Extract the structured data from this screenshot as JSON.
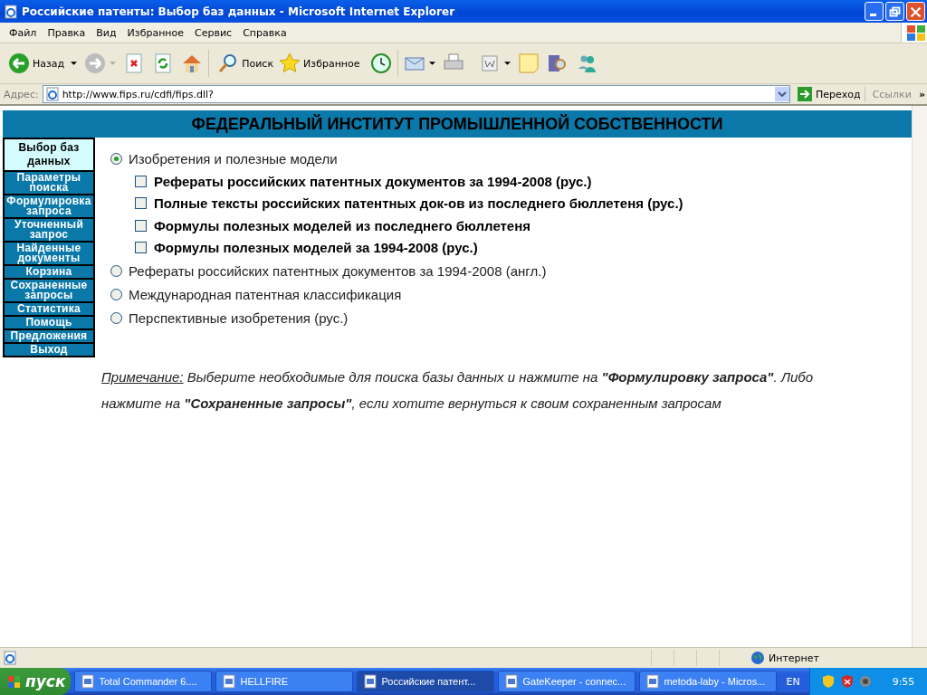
{
  "window": {
    "title": "Российские патенты: Выбор баз данных - Microsoft Internet Explorer"
  },
  "menu": [
    "Файл",
    "Правка",
    "Вид",
    "Избранное",
    "Сервис",
    "Справка"
  ],
  "toolbar": {
    "back": "Назад",
    "search": "Поиск",
    "favorites": "Избранное"
  },
  "address": {
    "label": "Адрес:",
    "value": "http://www.fips.ru/cdfi/fips.dll?",
    "go": "Переход",
    "links": "Ссылки",
    "more": "»"
  },
  "page": {
    "header": "ФЕДЕРАЛЬНЫЙ ИНСТИТУТ ПРОМЫШЛЕННОЙ СОБСТВЕННОСТИ",
    "sidebar": [
      {
        "label": "Выбор баз данных",
        "selected": true
      },
      {
        "label": "Параметры поиска",
        "selected": false
      },
      {
        "label": "Формулировка запроса",
        "selected": false
      },
      {
        "label": "Уточненный запрос",
        "selected": false
      },
      {
        "label": "Найденные документы",
        "selected": false
      },
      {
        "label": "Корзина",
        "selected": false
      },
      {
        "label": "Сохраненные запросы",
        "selected": false
      },
      {
        "label": "Статистика",
        "selected": false
      },
      {
        "label": "Помощь",
        "selected": false
      },
      {
        "label": "Предложения",
        "selected": false
      },
      {
        "label": "Выход",
        "selected": false
      }
    ],
    "databases": [
      {
        "label": "Изобретения и полезные модели",
        "selected": true,
        "children": [
          {
            "label": "Рефераты российских патентных документов за 1994-2008 (рус.)",
            "checked": false
          },
          {
            "label": "Полные тексты российских патентных док-ов из последнего бюллетеня (рус.)",
            "checked": false
          },
          {
            "label": "Формулы полезных моделей из последнего бюллетеня",
            "checked": false
          },
          {
            "label": "Формулы полезных моделей за 1994-2008 (рус.)",
            "checked": false
          }
        ]
      },
      {
        "label": "Рефераты российских патентных документов за 1994-2008 (англ.)",
        "selected": false
      },
      {
        "label": "Международная патентная классификация",
        "selected": false
      },
      {
        "label": "Перспективные изобретения (рус.)",
        "selected": false
      }
    ],
    "note": {
      "label": "Примечание:",
      "text": "Выберите необходимые для поиска базы данных и нажмите на **\"Формулировку запроса\"**. Либо нажмите на **\"Сохраненные запросы\"**, если хотите вернуться к своим сохраненным запросам"
    }
  },
  "status_bar": {
    "zone": "Интернет"
  },
  "taskbar": {
    "start": "пуск",
    "tasks": [
      {
        "label": "Total Commander 6....",
        "selected": false
      },
      {
        "label": "HELLFIRE",
        "selected": false
      },
      {
        "label": "Российские патент...",
        "selected": true
      },
      {
        "label": "GateKeeper - connec...",
        "selected": false
      },
      {
        "label": "metoda-laby - Micros...",
        "selected": false
      }
    ],
    "language": "EN",
    "clock": "9:55"
  }
}
